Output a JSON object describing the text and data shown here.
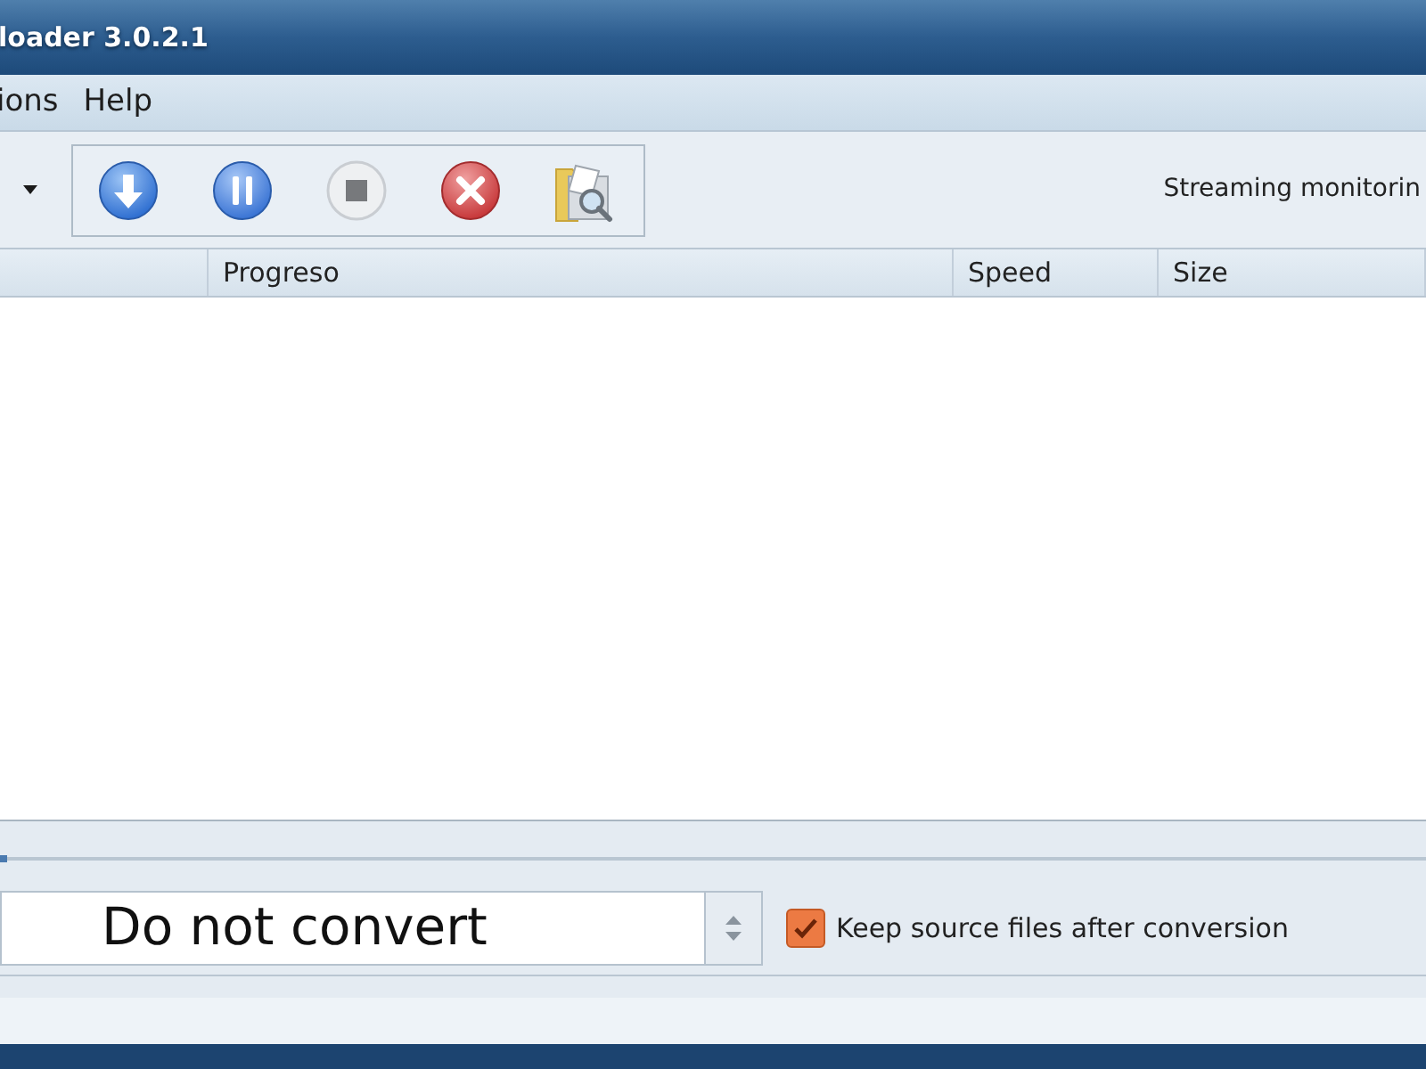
{
  "window": {
    "title": "loader 3.0.2.1"
  },
  "menu": [
    {
      "label": "ions"
    },
    {
      "label": "Help"
    }
  ],
  "toolbar": {
    "buttons": [
      {
        "kind": "download"
      },
      {
        "kind": "pause"
      },
      {
        "kind": "stop"
      },
      {
        "kind": "cancel"
      },
      {
        "kind": "browse"
      }
    ],
    "streaming_label": "Streaming monitorin"
  },
  "table": {
    "columns": [
      {
        "label": "Progreso"
      },
      {
        "label": "Speed"
      },
      {
        "label": "Size"
      }
    ]
  },
  "conversion": {
    "format": "Do not convert",
    "keep_source": {
      "label": "Keep source files after conversion",
      "checked": true
    }
  }
}
